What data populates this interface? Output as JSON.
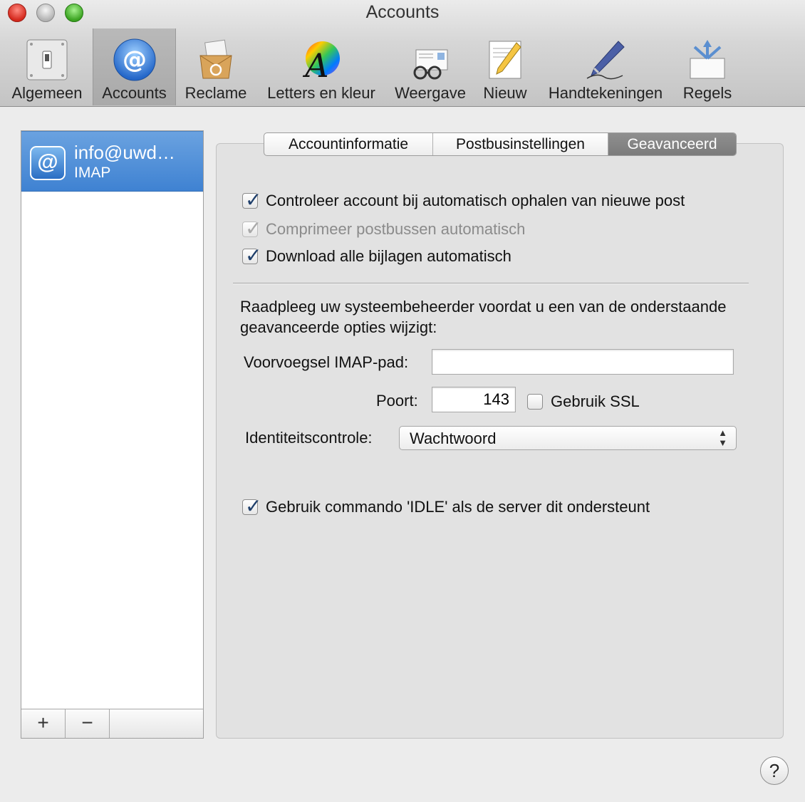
{
  "window": {
    "title": "Accounts"
  },
  "toolbar": {
    "items": [
      {
        "label": "Algemeen",
        "icon": "switch-icon"
      },
      {
        "label": "Accounts",
        "icon": "at-sign-icon",
        "selected": true
      },
      {
        "label": "Reclame",
        "icon": "junk-mail-icon"
      },
      {
        "label": "Letters en kleur",
        "icon": "font-color-icon"
      },
      {
        "label": "Weergave",
        "icon": "viewing-glasses-icon"
      },
      {
        "label": "Nieuw",
        "icon": "compose-pencil-icon"
      },
      {
        "label": "Handtekeningen",
        "icon": "signature-pen-icon"
      },
      {
        "label": "Regels",
        "icon": "rules-arrows-icon"
      }
    ]
  },
  "accounts": {
    "list": [
      {
        "name": "info@uwd…",
        "type": "IMAP",
        "selected": true
      }
    ],
    "add_label": "+",
    "remove_label": "−"
  },
  "tabs": [
    {
      "label": "Accountinformatie"
    },
    {
      "label": "Postbusinstellingen"
    },
    {
      "label": "Geavanceerd",
      "selected": true
    }
  ],
  "advanced": {
    "options": [
      {
        "label": "Controleer account bij automatisch ophalen van nieuwe post",
        "checked": true,
        "enabled": true
      },
      {
        "label": "Comprimeer postbussen automatisch",
        "checked": true,
        "enabled": false
      },
      {
        "label": "Download alle bijlagen automatisch",
        "checked": true,
        "enabled": true
      }
    ],
    "notice": "Raadpleeg uw systeembeheerder voordat u een van de onderstaande geavanceerde opties wijzigt:",
    "imap_prefix": {
      "label": "Voorvoegsel IMAP-pad:",
      "value": ""
    },
    "port": {
      "label": "Poort:",
      "value": "143"
    },
    "ssl": {
      "label": "Gebruik SSL",
      "checked": false
    },
    "auth": {
      "label": "Identiteitscontrole:",
      "value": "Wachtwoord"
    },
    "idle": {
      "label": "Gebruik commando 'IDLE' als de server dit ondersteunt",
      "checked": true
    }
  },
  "help": {
    "label": "?"
  }
}
